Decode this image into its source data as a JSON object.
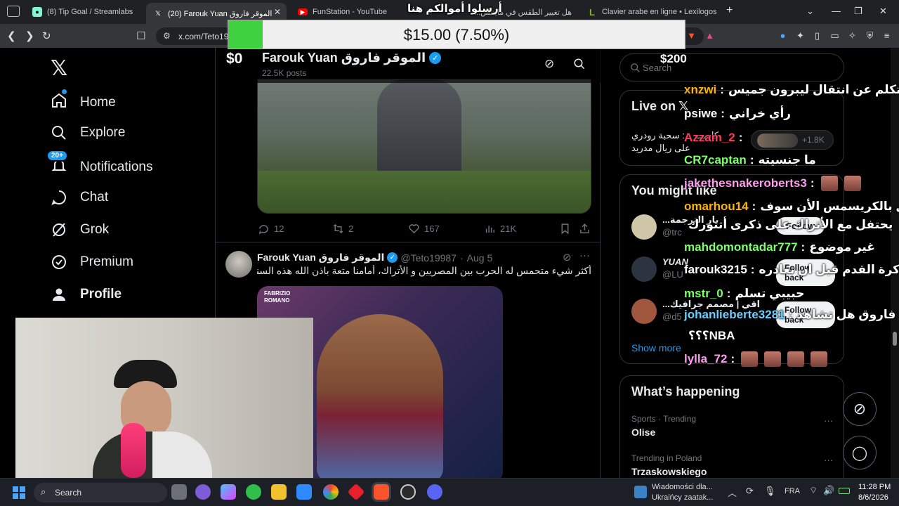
{
  "browser": {
    "tabs": [
      {
        "title": "(8) Tip Goal / Streamlabs",
        "icon": "streamlabs-icon",
        "color": "#80f5d2"
      },
      {
        "title": "(20) Farouk Yuan الموقر فاروق (@",
        "icon": "x-icon",
        "color": "#000000"
      },
      {
        "title": "FunStation - YouTube",
        "icon": "youtube-icon",
        "color": "#ff0000"
      },
      {
        "title": "هل تغيير الطقس في مايتنش...",
        "icon": "page-icon",
        "color": "#555555"
      },
      {
        "title": "Clavier arabe en ligne • Lexilogos",
        "icon": "lexilogos-icon",
        "color": "#7cbd1b"
      }
    ],
    "url": "x.com/Teto19"
  },
  "overlay": {
    "donation_amount": "$15.00 (7.50%)",
    "donation_fraction": 0.075,
    "goal_start": "$0",
    "goal_end": "$200",
    "title": "أرسلوا أموالكم هنا",
    "accent": "#3fd13f"
  },
  "left_nav": {
    "items": [
      {
        "label": "Home",
        "icon": "home-icon"
      },
      {
        "label": "Explore",
        "icon": "search-icon"
      },
      {
        "label": "Notifications",
        "icon": "bell-icon",
        "badge": "20+"
      },
      {
        "label": "Chat",
        "icon": "chat-icon"
      },
      {
        "label": "Grok",
        "icon": "grok-icon"
      },
      {
        "label": "Premium",
        "icon": "premium-icon"
      },
      {
        "label": "Profile",
        "icon": "profile-icon"
      }
    ]
  },
  "profile_header": {
    "name": "Farouk Yuan الموقر فاروق",
    "posts": "22.5K posts"
  },
  "post1": {
    "replies": "12",
    "reposts": "2",
    "likes": "167",
    "views": "21K"
  },
  "post2": {
    "name": "Farouk Yuan الموقر فاروق",
    "handle": "@Teto19987",
    "date": "Aug 5",
    "text": "أكثر شيء متحمس له الحرب بين المصريين و الأتراك، أمامنا متعة باذن الله هذه السنتين",
    "image_caption_line1": "FABRIZIO",
    "image_caption_line2": "ROMANO"
  },
  "right": {
    "search_placeholder": "Search",
    "live_title": "Live on",
    "live_text_line1": "كاست ...: سحبة رودري",
    "live_text_line2": "على ريال مدريد",
    "live_count": "+1.8K",
    "you_might_like": "You might like",
    "suggestions": [
      {
        "name": "...بار الترجمة",
        "handle": "@trc",
        "button": "Follow"
      },
      {
        "name": "YUAN",
        "handle": "@LU",
        "button": "Follow back"
      },
      {
        "name": "...اقي | مصمم جرافيك",
        "handle": "@d5",
        "button": "Follow back"
      }
    ],
    "show_more": "Show more",
    "whats_happening": "What’s happening",
    "trends": [
      {
        "context": "Sports · Trending",
        "name": "Olise"
      },
      {
        "context": "Trending in Poland",
        "name": "Trzaskowskiego"
      }
    ]
  },
  "chat": [
    {
      "user": "xnzwi",
      "color": "#ffb400",
      "msg": "طيب تكلم عن انتقال ليبرون جميس",
      "emotes": 0
    },
    {
      "user": "psiwe",
      "color": "#ffffff",
      "msg": "رأي خراني",
      "emotes": 0
    },
    {
      "user": "Azzam_2",
      "color": "#ff3b5c",
      "msg": "",
      "emotes": 0
    },
    {
      "user": "CR7captan",
      "color": "#7dff6b",
      "msg": "ما جنسيته",
      "emotes": 0
    },
    {
      "user": "jakethesnakeroberts3",
      "color": "#ff9cf0",
      "msg": "",
      "emotes": 2
    },
    {
      "user": "omarhou14",
      "color": "#ffb400",
      "msg": "يحتفل بالكريسمس الأن سوف",
      "emotes": 0
    },
    {
      "user": "",
      "color": "#ffffff",
      "msg": "يحتفل مع الأتراك على ذكرى أتتورك",
      "emotes": 0
    },
    {
      "user": "mahdomontadar777",
      "color": "#7dff6b",
      "msg": "غير موضوع",
      "emotes": 0
    },
    {
      "user": "farouk3215",
      "color": "#ffffff",
      "msg": "لقد غادر كرة القدم قبل ان تغادره",
      "emotes": 0
    },
    {
      "user": "mstr_0",
      "color": "#7dff6b",
      "msg": "حبيبي تسلم",
      "emotes": 0
    },
    {
      "user": "johanlieberte3281",
      "color": "#6ad0ff",
      "msg": "فاروق هل تشاهد",
      "emotes": 0
    },
    {
      "user": "",
      "color": "#ffffff",
      "msg": "NBA؟؟؟",
      "emotes": 0
    },
    {
      "user": "lylla_72",
      "color": "#ff9cf0",
      "msg": "",
      "emotes": 4
    }
  ],
  "taskbar": {
    "search": "Search",
    "news_line1": "Wiadomości dla...",
    "news_line2": "Ukraińcy zaatak...",
    "lang": "FRA",
    "time": "11:28 PM",
    "date": "8/6/2026"
  }
}
